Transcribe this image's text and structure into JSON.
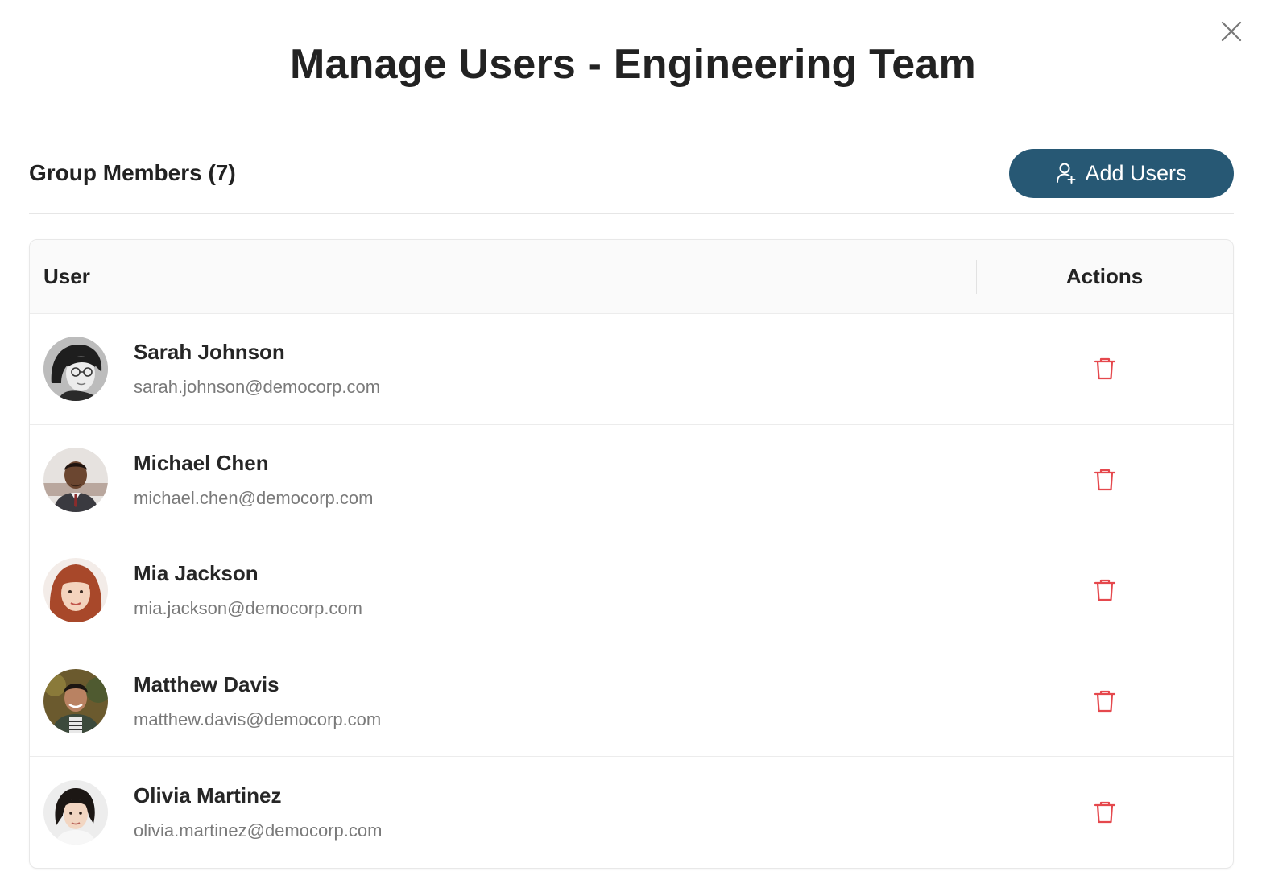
{
  "modal": {
    "title": "Manage Users - Engineering Team"
  },
  "section": {
    "title": "Group Members (7)",
    "add_button_label": "Add Users"
  },
  "table": {
    "columns": [
      "User",
      "Actions"
    ],
    "rows": [
      {
        "name": "Sarah Johnson",
        "email": "sarah.johnson@democorp.com",
        "avatar": "avatar-sarah"
      },
      {
        "name": "Michael Chen",
        "email": "michael.chen@democorp.com",
        "avatar": "avatar-michael"
      },
      {
        "name": "Mia Jackson",
        "email": "mia.jackson@democorp.com",
        "avatar": "avatar-mia"
      },
      {
        "name": "Matthew Davis",
        "email": "matthew.davis@democorp.com",
        "avatar": "avatar-matthew"
      },
      {
        "name": "Olivia Martinez",
        "email": "olivia.martinez@democorp.com",
        "avatar": "avatar-olivia"
      }
    ]
  },
  "icons": {
    "close": "close-icon",
    "add_user": "add-user-icon",
    "delete": "trash-icon"
  },
  "colors": {
    "primary": "#275874",
    "danger": "#e5484d",
    "text": "#222222",
    "muted": "#7a7a7a"
  }
}
